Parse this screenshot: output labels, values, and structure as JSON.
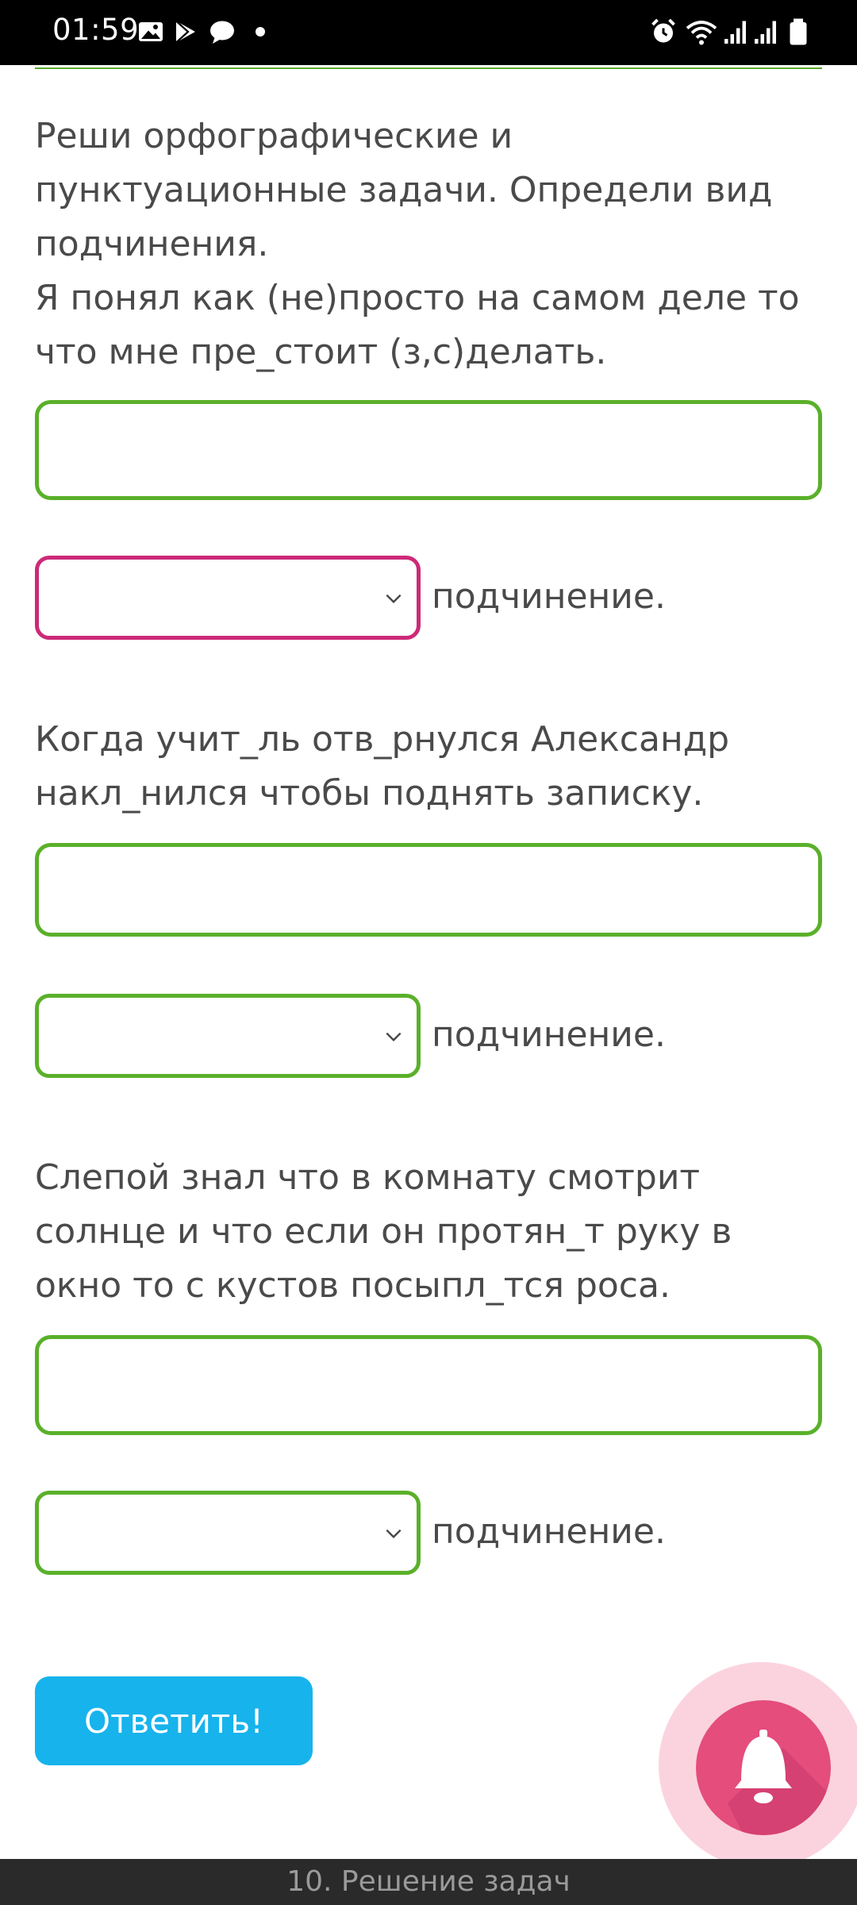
{
  "status_bar": {
    "time": "01:59",
    "left_icons": [
      "gallery-icon",
      "play-store-icon",
      "chat-bubble-icon",
      "dot-icon"
    ],
    "right_icons": [
      "alarm-icon",
      "wifi-icon",
      "signal-icon",
      "signal-icon",
      "battery-icon"
    ]
  },
  "task": {
    "instruction": "Реши орфографические и пунктуационные задачи. Определи вид подчинения.",
    "items": [
      {
        "sentence": "Я понял как (не)просто на самом деле то что мне пре_стоит (з,с)делать.",
        "answer_value": "",
        "select_value": "",
        "suffix": "подчинение."
      },
      {
        "sentence": "Когда учит_ль отв_рнулся Александр накл_нился чтобы поднять записку.",
        "answer_value": "",
        "select_value": "",
        "suffix": "подчинение."
      },
      {
        "sentence": "Слепой знал что в комнату смотрит солнце и что если он протян_т руку в окно то с кустов посыпл_тся роса.",
        "answer_value": "",
        "select_value": "",
        "suffix": "подчинение."
      }
    ],
    "submit_label": "Ответить!"
  },
  "bottom_bar": {
    "label": "10. Решение задач"
  },
  "colors": {
    "accent_green": "#5ab02a",
    "invalid_magenta": "#cc2a78",
    "button_blue": "#17b3ec",
    "bell_pink": "#e44d7c"
  }
}
